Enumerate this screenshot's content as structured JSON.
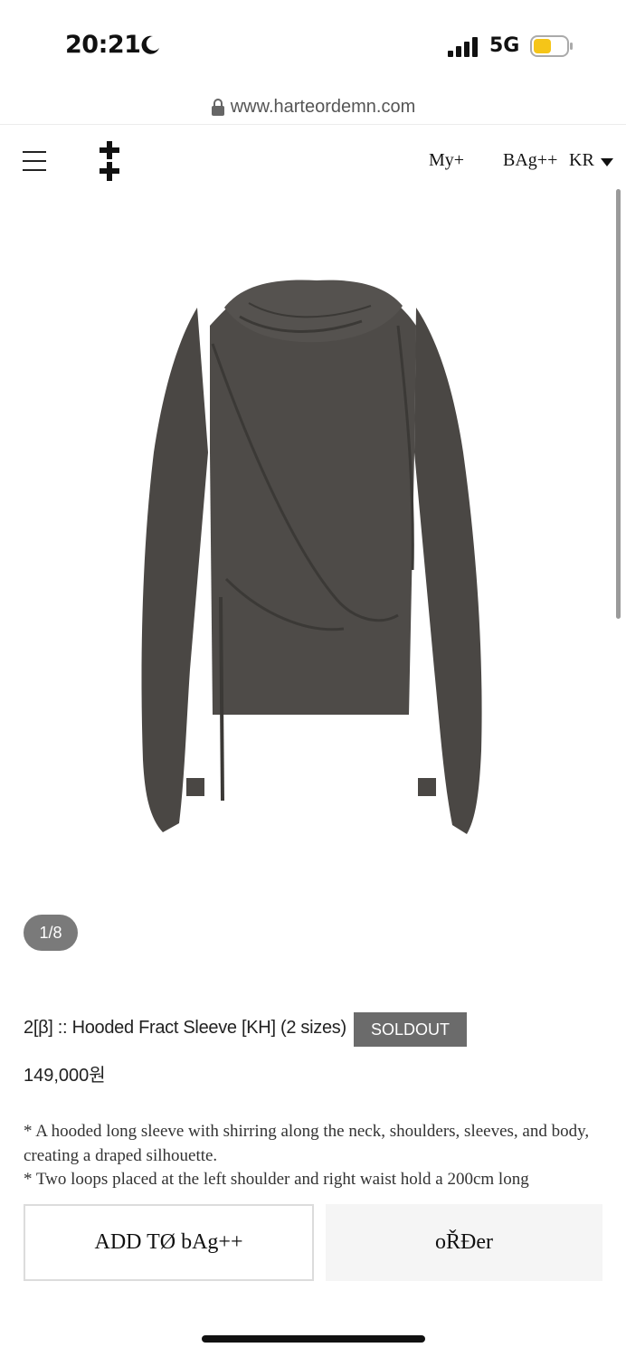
{
  "status_bar": {
    "time": "20:21",
    "network": "5G",
    "battery_color": "#f5c518"
  },
  "browser": {
    "url": "www.harteordemn.com"
  },
  "header": {
    "nav_my": "My+",
    "nav_bag": "BAg++",
    "nav_lang": "KR"
  },
  "gallery": {
    "pager": "1/8"
  },
  "product": {
    "name": "2[β] :: Hooded Fract Sleeve [KH] (2 sizes)",
    "status_badge": "SOLDOUT",
    "price": "149,000원",
    "description": [
      "* A hooded long sleeve with shirring along the neck, shoulders, sleeves, and body, creating a draped silhouette.",
      "* Two loops placed at the left shoulder and right waist hold a 200cm long"
    ]
  },
  "actions": {
    "add_to_bag": "ADD TØ bAg++",
    "order": "oŘĐer"
  },
  "colors": {
    "garment": "#4a4744",
    "badge_bg": "#6b6b6b",
    "order_bg": "#f5f5f5"
  }
}
